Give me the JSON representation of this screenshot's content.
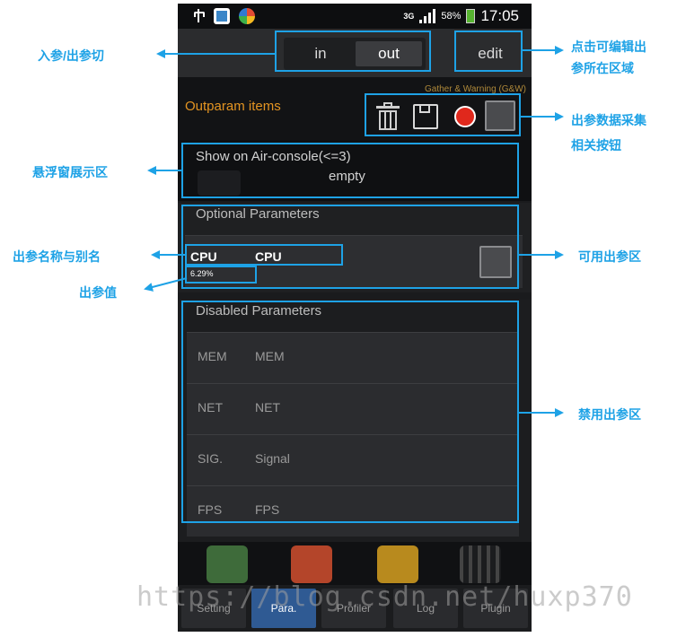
{
  "status_bar": {
    "network": "3G",
    "battery": "58%",
    "time": "17:05",
    "icons": [
      "usb-icon",
      "app-icon",
      "app-icon",
      "signal-icon",
      "battery-icon"
    ]
  },
  "segmented": {
    "in_label": "in",
    "out_label": "out",
    "selected": "out"
  },
  "edit_label": "edit",
  "outparam": {
    "title": "Outparam items",
    "gather_label": "Gather & Warning (G&W)",
    "buttons": [
      "trash-icon",
      "save-icon",
      "record-icon",
      "checkbox"
    ]
  },
  "air_console": {
    "title": "Show on Air-console(<=3)",
    "empty_text": "empty"
  },
  "optional": {
    "title": "Optional Parameters",
    "items": [
      {
        "name": "CPU",
        "alias": "CPU",
        "value": "6.29%"
      }
    ]
  },
  "disabled": {
    "title": "Disabled Parameters",
    "items": [
      {
        "name": "MEM",
        "alias": "MEM"
      },
      {
        "name": "NET",
        "alias": "NET"
      },
      {
        "name": "SIG.",
        "alias": "Signal"
      },
      {
        "name": "FPS",
        "alias": "FPS"
      }
    ]
  },
  "nav": {
    "tabs": [
      "Setting",
      "Para.",
      "Profiler",
      "Log",
      "Plugin"
    ],
    "active": "Para."
  },
  "annotations": {
    "in_out_switch": "入参/出参切",
    "edit_area": [
      "点击可编辑出",
      "参所在区域"
    ],
    "collect_buttons": [
      "出参数据采集",
      "相关按钮"
    ],
    "floating_window": "悬浮窗展示区",
    "name_alias": "出参名称与别名",
    "value": "出参值",
    "available": "可用出参区",
    "disabled": "禁用出参区"
  },
  "watermark": "https://blog.csdn.net/huxp370",
  "colors": {
    "annotation": "#1ea2e6",
    "accent_orange": "#e39422",
    "record_red": "#e0281c",
    "active_tab": "#2f5a93"
  }
}
